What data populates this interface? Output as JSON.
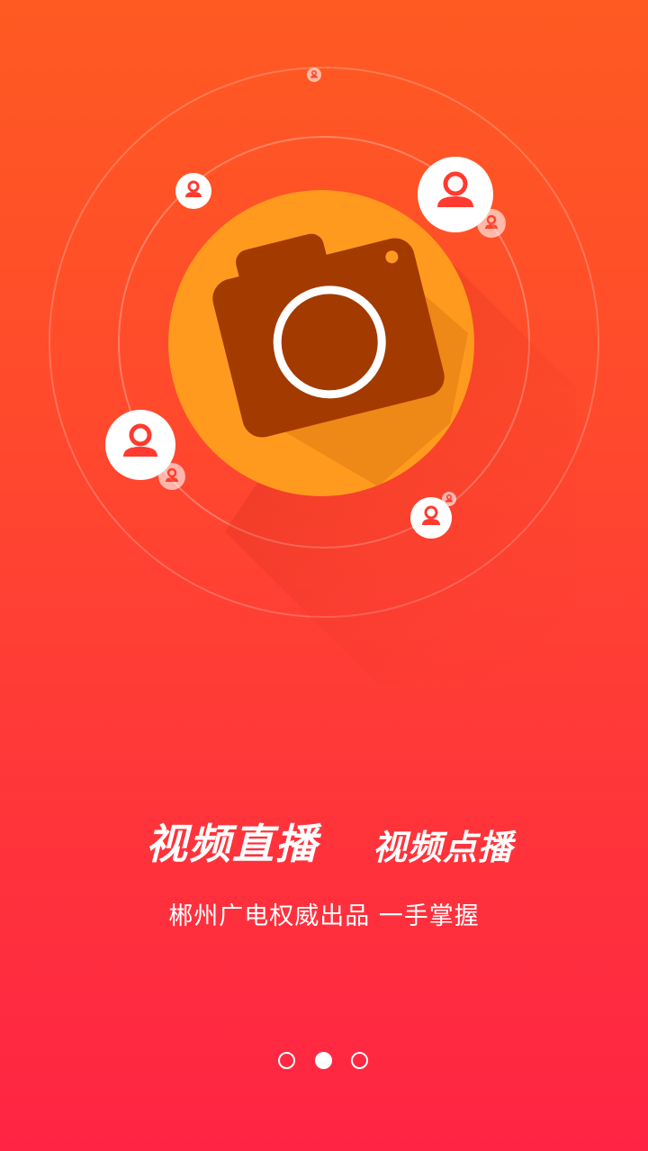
{
  "onboarding": {
    "headline_left": "视频直播",
    "headline_right": "视频点播",
    "subtitle": "郴州广电权威出品 一手掌握",
    "current_page": 2,
    "total_pages": 3
  },
  "icons": {
    "hero": "camera-icon",
    "orbiting": "user-avatar-icon"
  },
  "colors": {
    "background_top": "#ff5a22",
    "background_bottom": "#ff2444",
    "badge": "#ff9a1e",
    "camera": "#a33a00",
    "text": "#ffffff"
  }
}
